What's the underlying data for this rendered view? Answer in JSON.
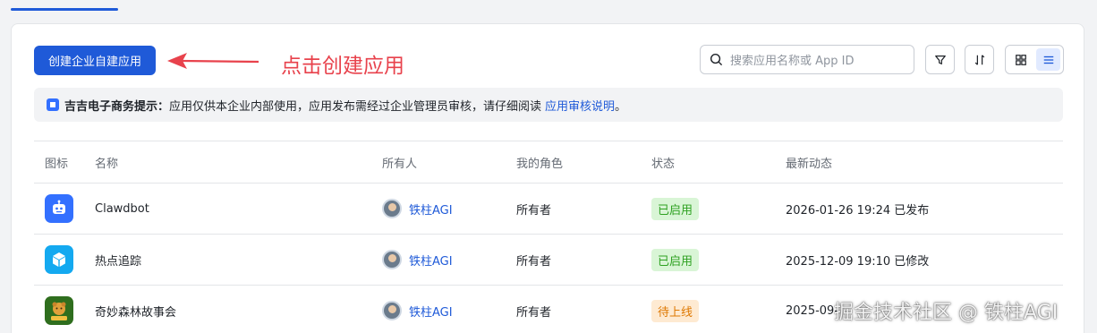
{
  "toolbar": {
    "create_label": "创建企业自建应用",
    "annotation": "点击创建应用",
    "search_placeholder": "搜索应用名称或 App ID"
  },
  "notice": {
    "title": "吉吉电子商务提示：",
    "text": "应用仅供本企业内部使用，应用发布需经过企业管理员审核，请仔细阅读",
    "link": "应用审核说明",
    "end": "。"
  },
  "table": {
    "headers": [
      "图标",
      "名称",
      "所有人",
      "我的角色",
      "状态",
      "最新动态"
    ],
    "rows": [
      {
        "name": "Clawdbot",
        "owner": "铁柱AGI",
        "role": "所有者",
        "status": "已启用",
        "activity": "2026-01-26 19:24 已发布",
        "icon": "robot-icon",
        "status_color": "green"
      },
      {
        "name": "热点追踪",
        "owner": "铁柱AGI",
        "role": "所有者",
        "status": "已启用",
        "activity": "2025-12-09 19:10 已修改",
        "icon": "box-icon",
        "status_color": "green"
      },
      {
        "name": "奇妙森林故事会",
        "owner": "铁柱AGI",
        "role": "所有者",
        "status": "待上线",
        "activity": "2025-09-",
        "icon": "forest-story-icon",
        "status_color": "orange"
      }
    ]
  },
  "watermark": "掘金技术社区 @ 铁柱AGI",
  "colors": {
    "primary": "#1f5ad8",
    "annotation": "#e8424c",
    "enabled": "#2ea121",
    "pending": "#de7802"
  }
}
